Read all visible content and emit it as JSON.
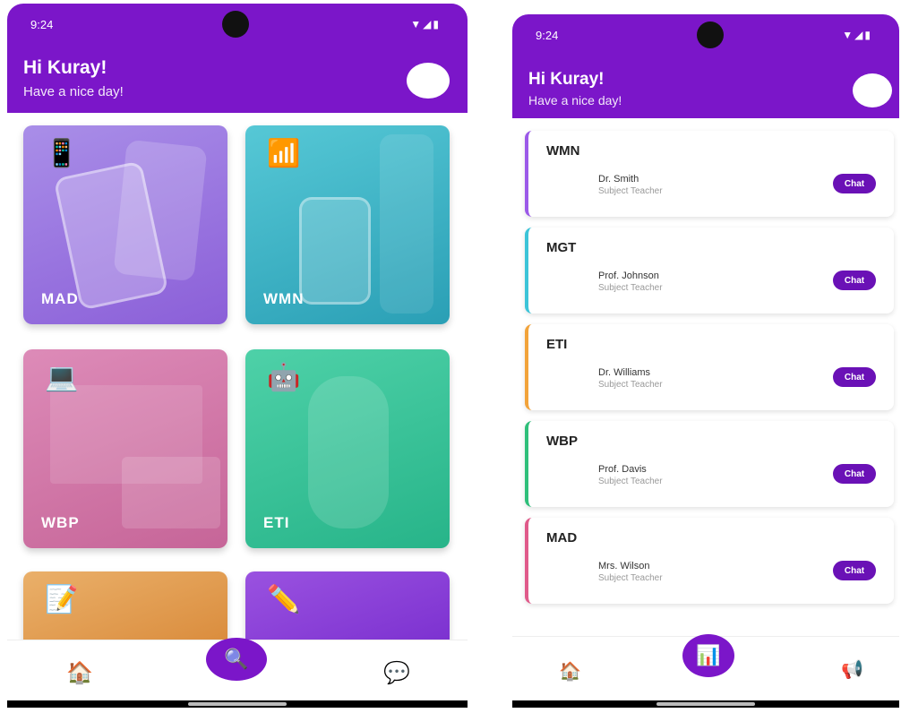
{
  "phone1": {
    "status": {
      "time": "9:24",
      "signal": "▼◢▮"
    },
    "header": {
      "greeting": "Hi Kuray!",
      "subtitle": "Have a nice day!"
    },
    "cards": [
      {
        "label": "MAD",
        "emoji": "📱",
        "color": "#9a6fe0"
      },
      {
        "label": "WMN",
        "emoji": "📶",
        "color": "#36b0c4"
      },
      {
        "label": "WBP",
        "emoji": "💻",
        "color": "#d076a8"
      },
      {
        "label": "ETI",
        "emoji": "🤖",
        "color": "#34c39c"
      },
      {
        "label": "",
        "emoji": "📝",
        "color": "#e09a4a"
      },
      {
        "label": "",
        "emoji": "✏️",
        "color": "#8a3fd6"
      }
    ],
    "nav": {
      "home": "🏠",
      "fab": "🔍",
      "chat": "💬"
    }
  },
  "phone2": {
    "status": {
      "time": "9:24",
      "signal": "▼◢▮"
    },
    "header": {
      "greeting": "Hi Kuray!",
      "subtitle": "Have a nice day!"
    },
    "subjects": [
      {
        "code": "WMN",
        "teacher": "Dr. Smith",
        "role": "Subject Teacher",
        "chat": "Chat",
        "accent": "#9b59e8"
      },
      {
        "code": "MGT",
        "teacher": "Prof. Johnson",
        "role": "Subject Teacher",
        "chat": "Chat",
        "accent": "#3cc4d8"
      },
      {
        "code": "ETI",
        "teacher": "Dr. Williams",
        "role": "Subject Teacher",
        "chat": "Chat",
        "accent": "#f2a33a"
      },
      {
        "code": "WBP",
        "teacher": "Prof. Davis",
        "role": "Subject Teacher",
        "chat": "Chat",
        "accent": "#2fbf7a"
      },
      {
        "code": "MAD",
        "teacher": "Mrs. Wilson",
        "role": "Subject Teacher",
        "chat": "Chat",
        "accent": "#e05a8a"
      }
    ],
    "nav": {
      "home": "🏠",
      "fab": "📊",
      "announce": "📢"
    }
  }
}
